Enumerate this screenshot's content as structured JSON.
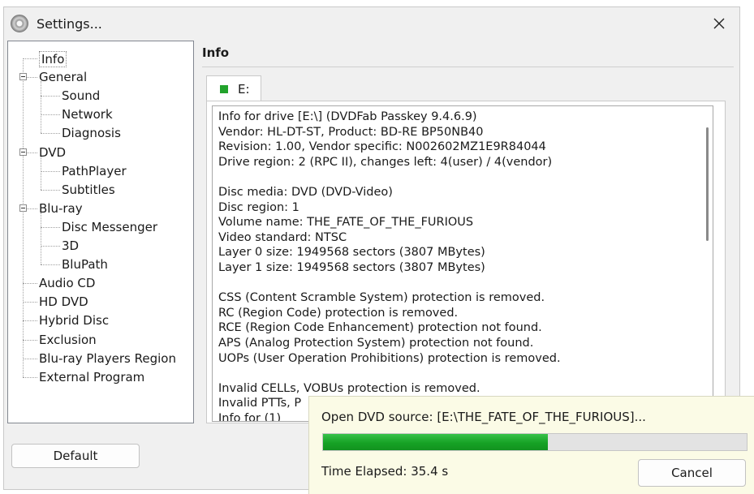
{
  "window": {
    "title": "Settings...",
    "app_icon": "disc-icon",
    "close_icon": "close-icon"
  },
  "tree": [
    {
      "label": "Info",
      "selected": true
    },
    {
      "label": "General",
      "expanded": true
    },
    {
      "label": "Sound"
    },
    {
      "label": "Network"
    },
    {
      "label": "Diagnosis"
    },
    {
      "label": "DVD",
      "expanded": true
    },
    {
      "label": "PathPlayer"
    },
    {
      "label": "Subtitles"
    },
    {
      "label": "Blu-ray",
      "expanded": true
    },
    {
      "label": "Disc Messenger"
    },
    {
      "label": "3D"
    },
    {
      "label": "BluPath"
    },
    {
      "label": "Audio CD"
    },
    {
      "label": "HD DVD"
    },
    {
      "label": "Hybrid Disc"
    },
    {
      "label": "Exclusion"
    },
    {
      "label": "Blu-ray Players Region"
    },
    {
      "label": "External Program"
    }
  ],
  "main": {
    "section_title": "Info",
    "tab": {
      "label": "E:",
      "status_color": "#22a32c"
    },
    "info_lines": [
      "Info for drive [E:\\] (DVDFab Passkey 9.4.6.9)",
      "Vendor: HL-DT-ST, Product: BD-RE BP50NB40",
      "Revision: 1.00, Vendor specific: N002602MZ1E9R84044",
      "Drive region: 2 (RPC II), changes left: 4(user) / 4(vendor)",
      "",
      "Disc media: DVD (DVD-Video)",
      "Disc region: 1",
      "Volume name: THE_FATE_OF_THE_FURIOUS",
      "Video standard: NTSC",
      "Layer 0 size: 1949568 sectors (3807 MBytes)",
      "Layer 1 size: 1949568 sectors (3807 MBytes)",
      "",
      "CSS (Content Scramble System) protection is removed.",
      "RC (Region Code) protection is removed.",
      "RCE (Region Code Enhancement) protection not found.",
      "APS (Analog Protection System) protection not found.",
      "UOPs (User Operation Prohibitions) protection is removed.",
      "",
      "Invalid CELLs, VOBUs protection is removed.",
      "Invalid PTTs, P",
      "Info for (1) "
    ]
  },
  "footer": {
    "default_label": "Default"
  },
  "progress": {
    "message": "Open DVD source: [E:\\THE_FATE_OF_THE_FURIOUS]...",
    "fraction": 0.53,
    "elapsed": "Time Elapsed: 35.4 s",
    "cancel_label": "Cancel",
    "bar_color": "#16a225"
  }
}
